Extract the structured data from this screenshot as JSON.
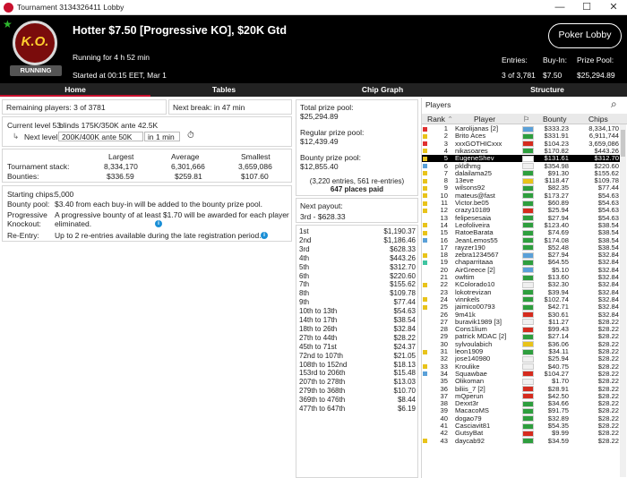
{
  "window": {
    "title": "Tournament 3134326411 Lobby",
    "controls": [
      "—",
      "☐",
      "✕"
    ]
  },
  "header": {
    "badge": "K.O.",
    "status": "RUNNING",
    "title": "Hotter $7.50 [Progressive KO], $20K Gtd",
    "running_for": "Running for 4 h 52 min",
    "started": "Started at 00:15 EET, Mar 1",
    "lobby_button": "Poker Lobby",
    "entries_label": "Entries:",
    "entries_value": "3 of 3,781",
    "buyin_label": "Buy-In:",
    "buyin_value": "$7.50",
    "prize_label": "Prize Pool:",
    "prize_value": "$25,294.89"
  },
  "tabs": [
    "Home",
    "Tables",
    "Chip Graph",
    "Structure"
  ],
  "left": {
    "remaining": "Remaining players: 3 of 3781",
    "next_break": "Next break: in 47 min",
    "current_level_label": "Current level 53:",
    "current_level_value": "blinds 175K/350K ante 42.5K",
    "next_level_label": "Next level:",
    "next_level_value": "200K/400K ante 50K",
    "next_level_time": "in 1 min",
    "stack_cols": [
      "Largest",
      "Average",
      "Smallest"
    ],
    "stack_label": "Tournament stack:",
    "stack_values": [
      "8,334,170",
      "6,301,666",
      "3,659,086"
    ],
    "bounty_label": "Bounties:",
    "bounty_values": [
      "$336.59",
      "$259.81",
      "$107.60"
    ],
    "starting_chips_label": "Starting chips:",
    "starting_chips_value": "5,000",
    "bounty_pool_label": "Bounty pool:",
    "bounty_pool_value": "$3.40 from each buy-in will be added to the bounty prize pool.",
    "pk_label_1": "Progressive",
    "pk_label_2": "Knockout:",
    "pk_value": "A progressive bounty of at least $1.70 will be awarded for each player eliminated.",
    "reentry_label": "Re-Entry:",
    "reentry_value": "Up to 2 re-entries available during the late registration period."
  },
  "middle": {
    "total_label": "Total prize pool:",
    "total_value": "$25,294.89",
    "regular_label": "Regular prize pool:",
    "regular_value": "$12,439.49",
    "bounty_label": "Bounty prize pool:",
    "bounty_value": "$12,855.40",
    "entries_note": "(3,220 entries, 561 re-entries)",
    "places_paid": "647 places paid",
    "next_payout_label": "Next payout:",
    "next_payout_value": "3rd - $628.33",
    "payouts": [
      [
        "1st",
        "$1,190.37"
      ],
      [
        "2nd",
        "$1,186.46"
      ],
      [
        "3rd",
        "$628.33"
      ],
      [
        "4th",
        "$443.26"
      ],
      [
        "5th",
        "$312.70"
      ],
      [
        "6th",
        "$220.60"
      ],
      [
        "7th",
        "$155.62"
      ],
      [
        "8th",
        "$109.78"
      ],
      [
        "9th",
        "$77.44"
      ],
      [
        "10th to 13th",
        "$54.63"
      ],
      [
        "14th to 17th",
        "$38.54"
      ],
      [
        "18th to 26th",
        "$32.84"
      ],
      [
        "27th to 44th",
        "$28.22"
      ],
      [
        "45th to 71st",
        "$24.37"
      ],
      [
        "72nd to 107th",
        "$21.05"
      ],
      [
        "108th to 152nd",
        "$18.13"
      ],
      [
        "153rd to 206th",
        "$15.48"
      ],
      [
        "207th to 278th",
        "$13.03"
      ],
      [
        "279th to 368th",
        "$10.70"
      ],
      [
        "369th to 476th",
        "$8.44"
      ],
      [
        "477th to 647th",
        "$6.19"
      ]
    ]
  },
  "players": {
    "title": "Players",
    "columns": [
      "Rank",
      "Player",
      "Bounty",
      "Chips"
    ],
    "rows": [
      [
        "1",
        "Karolijanas [2]",
        "$333.23",
        "8,334,170",
        "#e03030",
        "#5aa0d8"
      ],
      [
        "2",
        "Brito Aces",
        "$331.91",
        "6,911,744",
        "#e8c31a",
        "#2e9e3e"
      ],
      [
        "3",
        "xxxGOTHICxxx",
        "$104.23",
        "3,659,086",
        "#e03030",
        "#d52b1e"
      ],
      [
        "4",
        "nikasoares",
        "$170.82",
        "$443.26",
        "#e8c31a",
        "#2e9e3e"
      ],
      [
        "5",
        "EugeneShev",
        "$131.61",
        "$312.70",
        "#e8c31a",
        "#ffffff"
      ],
      [
        "6",
        "pkldhmg",
        "$354.98",
        "$220.60",
        "#5aa0d8",
        "#f0f0f0"
      ],
      [
        "7",
        "dalailama25",
        "$91.30",
        "$155.62",
        "#e8c31a",
        "#2e9e3e"
      ],
      [
        "8",
        "13eve",
        "$118.47",
        "$109.78",
        "#e8c31a",
        "#e8c31a"
      ],
      [
        "9",
        "wilsons92",
        "$82.35",
        "$77.44",
        "#e8c31a",
        "#2e9e3e"
      ],
      [
        "10",
        "mateus@fast",
        "$173.27",
        "$54.63",
        "#e8c31a",
        "#2e9e3e"
      ],
      [
        "11",
        "Victor.be05",
        "$60.89",
        "$54.63",
        "#e8c31a",
        "#2e9e3e"
      ],
      [
        "12",
        "crazy10189",
        "$25.94",
        "$54.63",
        "#e8c31a",
        "#d52b1e"
      ],
      [
        "13",
        "felipesesaia",
        "$27.94",
        "$54.63",
        "",
        "#2e9e3e"
      ],
      [
        "14",
        "Leofoliveira",
        "$123.40",
        "$38.54",
        "#e8c31a",
        "#2e9e3e"
      ],
      [
        "15",
        "RatoeBarata",
        "$74.69",
        "$38.54",
        "#e8c31a",
        "#2e9e3e"
      ],
      [
        "16",
        "JeanLemos55",
        "$174.08",
        "$38.54",
        "#5aa0d8",
        "#2e9e3e"
      ],
      [
        "17",
        "rayzer190",
        "$52.48",
        "$38.54",
        "",
        "#2e9e3e"
      ],
      [
        "18",
        "zebra1234567",
        "$27.94",
        "$32.84",
        "#e8c31a",
        "#5aa0d8"
      ],
      [
        "19",
        "chaparritaaa",
        "$64.55",
        "$32.84",
        "#3ec4a0",
        "#2e9e3e"
      ],
      [
        "20",
        "AirGreece [2]",
        "$5.10",
        "$32.84",
        "",
        "#5aa0d8"
      ],
      [
        "21",
        "owltim",
        "$13.60",
        "$32.84",
        "",
        "#2e9e3e"
      ],
      [
        "22",
        "KColorado10",
        "$32.30",
        "$32.84",
        "#e8c31a",
        "#f0f0f0"
      ],
      [
        "23",
        "lokotrevizan",
        "$39.94",
        "$32.84",
        "",
        "#2e9e3e"
      ],
      [
        "24",
        "vinnkels",
        "$102.74",
        "$32.84",
        "#e8c31a",
        "#2e9e3e"
      ],
      [
        "25",
        "jaimico00793",
        "$42.71",
        "$32.84",
        "#e8c31a",
        "#2e9e3e"
      ],
      [
        "26",
        "9m41k",
        "$30.61",
        "$32.84",
        "",
        "#d52b1e"
      ],
      [
        "27",
        "buravik1989 [3]",
        "$11.27",
        "$28.22",
        "",
        "#f0f0f0"
      ],
      [
        "28",
        "Cons1lium",
        "$99.43",
        "$28.22",
        "",
        "#d52b1e"
      ],
      [
        "29",
        "patrick MDAC [2]",
        "$27.14",
        "$28.22",
        "",
        "#2e9e3e"
      ],
      [
        "30",
        "sylvoulabich",
        "$36.06",
        "$28.22",
        "",
        "#e8c31a"
      ],
      [
        "31",
        "leon1909",
        "$34.11",
        "$28.22",
        "#e8c31a",
        "#2e9e3e"
      ],
      [
        "32",
        "jose140980",
        "$25.94",
        "$28.22",
        "",
        "#f0f0f0"
      ],
      [
        "33",
        "Kroulike",
        "$40.75",
        "$28.22",
        "#e8c31a",
        "#f0f0f0"
      ],
      [
        "34",
        "Squawbae",
        "$104.27",
        "$28.22",
        "#5aa0d8",
        "#d52b1e"
      ],
      [
        "35",
        "Olikoman",
        "$1.70",
        "$28.22",
        "",
        "#f0f0f0"
      ],
      [
        "36",
        "biliis_7 [2]",
        "$28.91",
        "$28.22",
        "",
        "#d52b1e"
      ],
      [
        "37",
        "mQperun",
        "$42.50",
        "$28.22",
        "",
        "#d52b1e"
      ],
      [
        "38",
        "Dexxt3r",
        "$34.66",
        "$28.22",
        "",
        "#2e9e3e"
      ],
      [
        "39",
        "MacacoMS",
        "$91.75",
        "$28.22",
        "",
        "#2e9e3e"
      ],
      [
        "40",
        "dogao79",
        "$32.89",
        "$28.22",
        "",
        "#2e9e3e"
      ],
      [
        "41",
        "Casciavit81",
        "$54.35",
        "$28.22",
        "",
        "#2e9e3e"
      ],
      [
        "42",
        "GutsyBat",
        "$9.99",
        "$28.22",
        "",
        "#d52b1e"
      ],
      [
        "43",
        "daycab92",
        "$34.59",
        "$28.22",
        "#e8c31a",
        "#2e9e3e"
      ]
    ]
  }
}
